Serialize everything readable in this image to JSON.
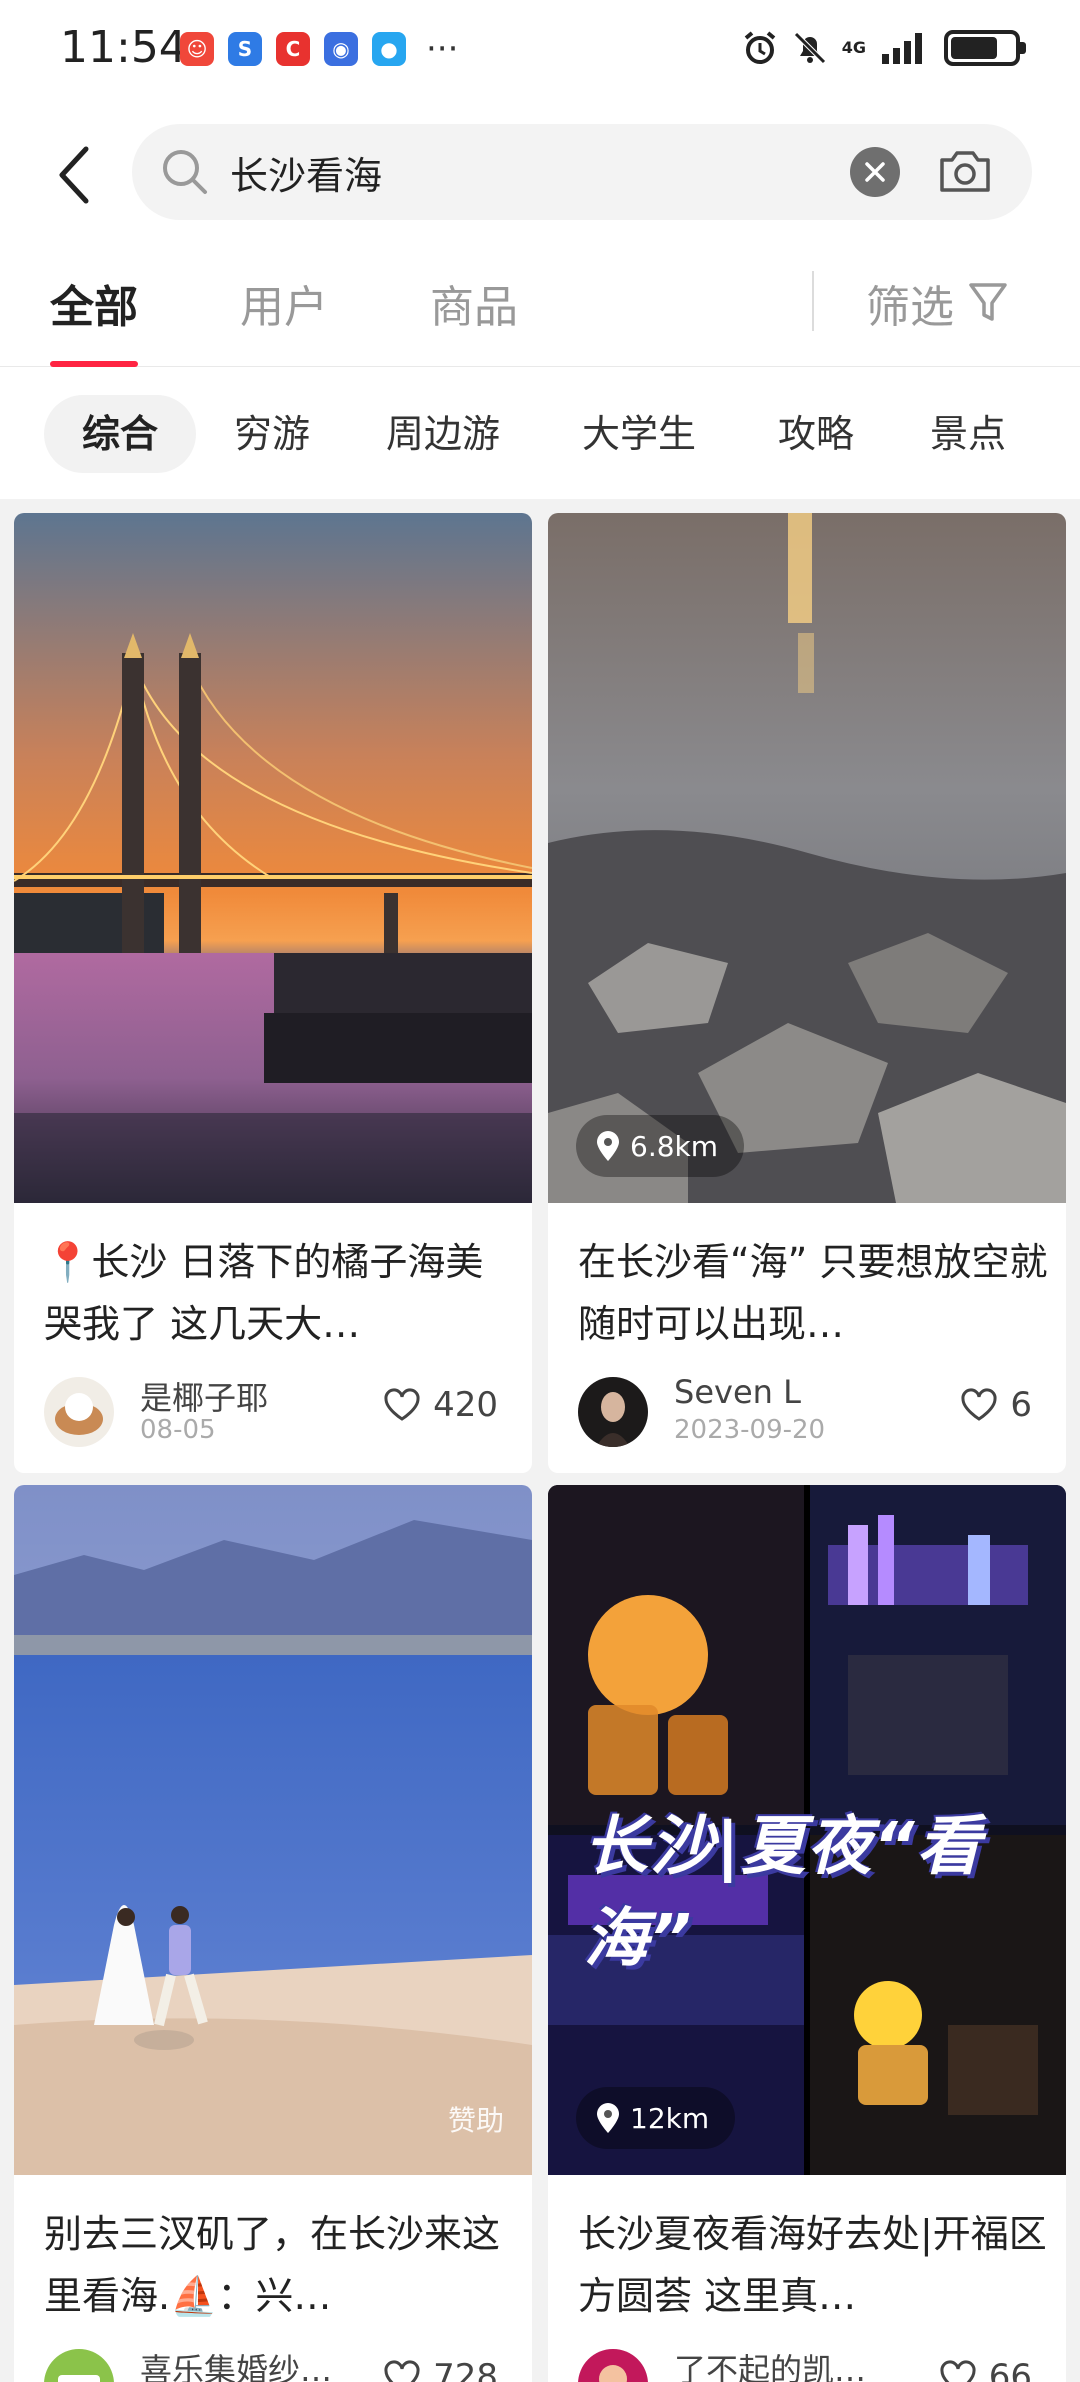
{
  "status_bar": {
    "time": "11:54",
    "network": "4G",
    "more": "···"
  },
  "search": {
    "query": "长沙看海"
  },
  "tabs": [
    {
      "label": "全部",
      "active": true
    },
    {
      "label": "用户",
      "active": false
    },
    {
      "label": "商品",
      "active": false
    }
  ],
  "filter_label": "筛选",
  "chips": [
    {
      "label": "综合",
      "active": true
    },
    {
      "label": "穷游",
      "active": false
    },
    {
      "label": "周边游",
      "active": false
    },
    {
      "label": "大学生",
      "active": false
    },
    {
      "label": "攻略",
      "active": false
    },
    {
      "label": "景点",
      "active": false
    }
  ],
  "cards": [
    {
      "title": "📍长沙 日落下的橘子海美哭我了 这几天大…",
      "author": "是椰子耶",
      "date": "08-05",
      "likes": "420",
      "image": "bridge-sunset-photo"
    },
    {
      "title": "在长沙看“海” 只要想放空就随时可以出现…",
      "author": "Seven L",
      "date": "2023-09-20",
      "likes": "6",
      "distance": "6.8km",
      "image": "rocks-water-photo"
    },
    {
      "title": "别去三汊矶了，在长沙来这里看海.⛵：兴…",
      "author": "喜乐集婚纱…",
      "date": "",
      "likes": "728",
      "sponsor": "赞助",
      "image": "beach-wedding-photo"
    },
    {
      "title": "长沙夏夜看海好去处|开福区方圆荟 这里真…",
      "author": "了不起的凯…",
      "date": "",
      "likes": "66",
      "distance": "12km",
      "overlay": "长沙|夏夜“看海”",
      "image": "night-collage-photo"
    }
  ],
  "colors": {
    "accent": "#ff2442",
    "background": "#f2f2f2"
  }
}
